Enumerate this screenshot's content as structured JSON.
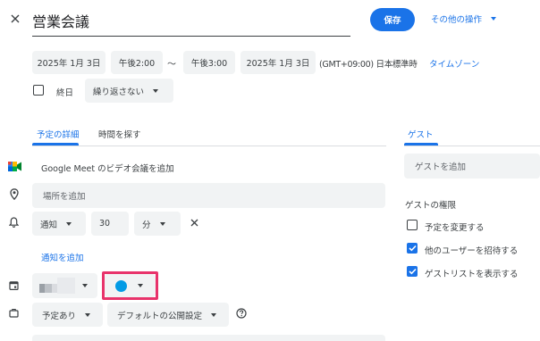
{
  "header": {
    "close_icon": "close-icon",
    "title": "営業会議",
    "save_label": "保存",
    "more_actions_label": "その他の操作"
  },
  "datetime": {
    "start_date": "2025年 1月 3日",
    "start_time": "午後2:00",
    "separator": "～",
    "end_time": "午後3:00",
    "end_date": "2025年 1月 3日",
    "timezone_text": "(GMT+09:00) 日本標準時",
    "timezone_link": "タイムゾーン",
    "all_day_label": "終日",
    "all_day_checked": false,
    "repeat_value": "繰り返さない"
  },
  "tabs": {
    "details": "予定の詳細",
    "find_time": "時間を探す",
    "guests": "ゲスト",
    "active_color": "#1a73e8"
  },
  "details": {
    "meet_label": "Google Meet のビデオ会議を追加",
    "location_placeholder": "場所を追加",
    "notification": {
      "type": "通知",
      "value": "30",
      "unit": "分"
    },
    "add_notification_label": "通知を追加",
    "event_color": "#039be5",
    "highlight_color": "#e8336b",
    "busy_value": "予定あり",
    "visibility_value": "デフォルトの公開設定",
    "help_icon": "help-icon"
  },
  "guests": {
    "add_placeholder": "ゲストを追加",
    "permissions_title": "ゲストの権限",
    "permissions": [
      {
        "label": "予定を変更する",
        "checked": false
      },
      {
        "label": "他のユーザーを招待する",
        "checked": true
      },
      {
        "label": "ゲストリストを表示する",
        "checked": true
      }
    ]
  }
}
